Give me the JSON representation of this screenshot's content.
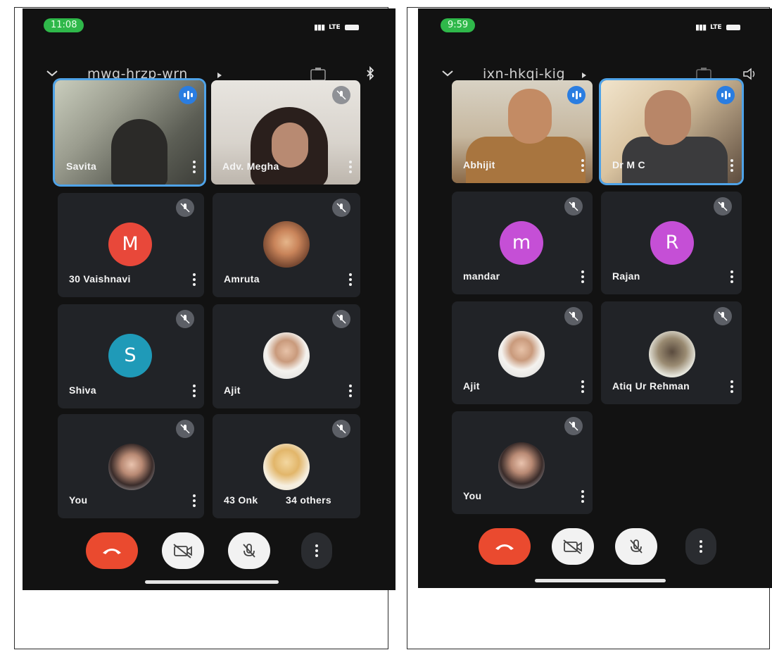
{
  "left_phone": {
    "status_time": "11:08",
    "status_network": "LTE",
    "meeting_code": "mwg-hrzp-wrn",
    "tiles": [
      {
        "name": "Savita",
        "type": "video",
        "speaking": true
      },
      {
        "name": "Adv. Megha",
        "type": "video",
        "speaking": false
      },
      {
        "name": "30 Vaishnavi",
        "type": "letter",
        "letter": "M",
        "color": "#e8483a"
      },
      {
        "name": "Amruta",
        "type": "photo"
      },
      {
        "name": "Shiva",
        "type": "letter",
        "letter": "S",
        "color": "#1f9ab8"
      },
      {
        "name": "Ajit",
        "type": "photo"
      },
      {
        "name": "You",
        "type": "photo"
      },
      {
        "name": "43 Onk",
        "others": "34 others",
        "type": "photo"
      }
    ]
  },
  "right_phone": {
    "status_time": "9:59",
    "status_network": "LTE",
    "meeting_code": "ixn-hkqi-kig",
    "tiles": [
      {
        "name": "Abhijit",
        "type": "video",
        "speaking": false
      },
      {
        "name": "Dr M C",
        "type": "video",
        "speaking": true
      },
      {
        "name": "mandar",
        "type": "letter",
        "letter": "m",
        "color": "#c54fd6"
      },
      {
        "name": "Rajan",
        "type": "letter",
        "letter": "R",
        "color": "#c54fd6"
      },
      {
        "name": "Ajit",
        "type": "photo"
      },
      {
        "name": "Atiq Ur Rehman",
        "type": "photo"
      },
      {
        "name": "You",
        "type": "photo"
      }
    ]
  },
  "colors": {
    "end_call": "#ea4a2f",
    "speaking_border": "#4fa3e8",
    "tile_bg": "#212327",
    "time_pill": "#2fb84a"
  }
}
